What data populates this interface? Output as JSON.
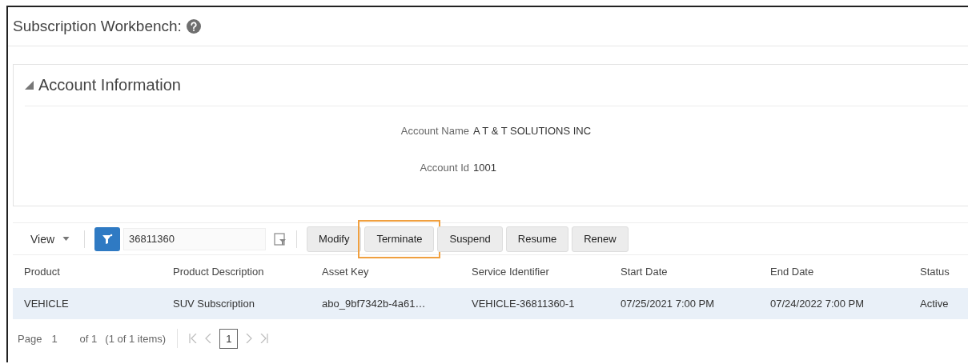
{
  "page": {
    "title": "Subscription Workbench:"
  },
  "account_section": {
    "title": "Account Information",
    "expanded": true,
    "fields": [
      {
        "label": "Account Name",
        "value": "A T & T SOLUTIONS INC"
      },
      {
        "label": "Account Id",
        "value": "1001"
      }
    ]
  },
  "toolbar": {
    "view_menu": "View",
    "filter_active": true,
    "search": {
      "value": "36811360"
    },
    "buttons": [
      {
        "label": "Modify",
        "highlighted": false
      },
      {
        "label": "Terminate",
        "highlighted": true
      },
      {
        "label": "Suspend",
        "highlighted": false
      },
      {
        "label": "Resume",
        "highlighted": false
      },
      {
        "label": "Renew",
        "highlighted": false
      }
    ]
  },
  "table": {
    "columns": [
      "Product",
      "Product Description",
      "Asset Key",
      "Service Identifier",
      "Start Date",
      "End Date",
      "Status"
    ],
    "rows": [
      {
        "cells": [
          "VEHICLE",
          "SUV Subscription",
          "abo_9bf7342b-4a61…",
          "VEHICLE-36811360-1",
          "07/25/2021 7:00 PM",
          "07/24/2022 7:00 PM",
          "Active"
        ],
        "selected": true
      }
    ]
  },
  "pagination": {
    "page_label": "Page",
    "page": "1",
    "of_total": "of 1",
    "items": "(1 of 1 items)",
    "current": "1"
  }
}
